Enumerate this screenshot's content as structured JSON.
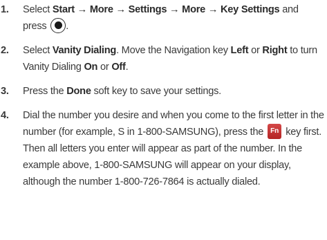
{
  "steps": [
    {
      "number": "1.",
      "parts": [
        "Select ",
        "Start → More → Settings → More → Key Settings",
        " and press "
      ],
      "tail": "."
    },
    {
      "number": "2.",
      "parts": [
        "Select ",
        "Vanity Dialing",
        ". Move the Navigation key ",
        "Left",
        " or ",
        "Right",
        " to turn Vanity Dialing ",
        "On",
        " or ",
        "Off",
        "."
      ]
    },
    {
      "number": "3.",
      "parts": [
        "Press the ",
        "Done",
        " soft key to save your settings."
      ]
    },
    {
      "number": "4.",
      "before_key": "Dial the number you desire and when you come to the first letter in the number (for example, S in 1-800-SAMSUNG), press the",
      "key_label": "Fn",
      "after_key": "key first. Then all letters you enter will appear as part of the number. In the example above, 1-800-SAMSUNG will appear on your display, although the number 1-800-726-7864 is actually dialed."
    }
  ],
  "icons": {
    "ok_key": "ok-key-icon",
    "fn_key": "fn-key-icon"
  },
  "colors": {
    "text": "#3a3a3a",
    "fn_key_background": "#c43434"
  }
}
